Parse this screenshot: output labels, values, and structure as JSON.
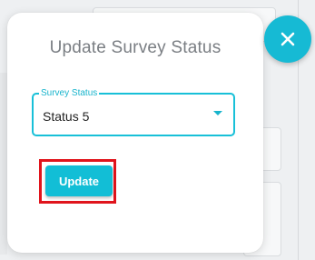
{
  "dialog": {
    "title": "Update Survey Status",
    "field": {
      "label": "Survey Status",
      "value": "Status 5"
    },
    "update_button": "Update"
  },
  "icons": {
    "close": "close-icon",
    "dropdown": "dropdown-arrow-icon"
  },
  "colors": {
    "accent": "#18c0d8",
    "highlight": "#e0141c",
    "title": "#7a7e83"
  }
}
